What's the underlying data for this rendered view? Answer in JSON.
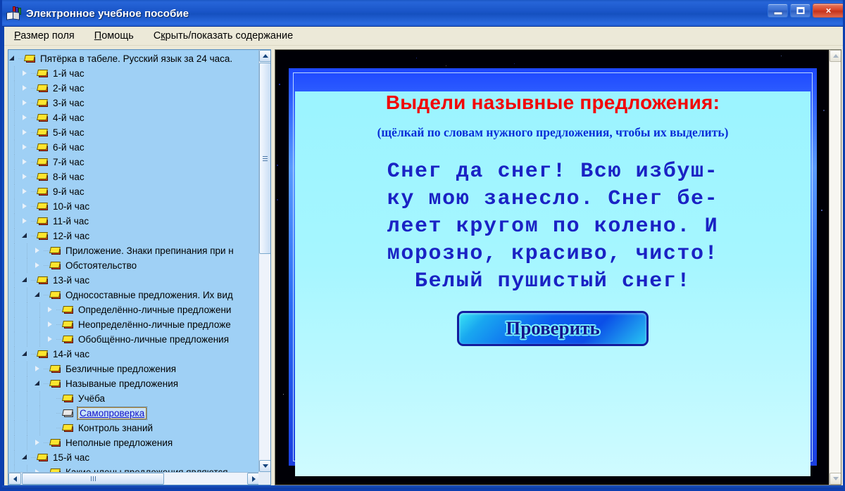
{
  "window": {
    "title": "Электронное учебное пособие",
    "icon": "open-book-icon",
    "buttons": {
      "minimize": "minimize-icon",
      "maximize": "maximize-icon",
      "close": "×"
    }
  },
  "menu": {
    "items": [
      {
        "id": "field-size",
        "pre": "",
        "acc": "Р",
        "post": "азмер поля"
      },
      {
        "id": "help",
        "pre": "",
        "acc": "П",
        "post": "омощь"
      },
      {
        "id": "toggle-contents",
        "pre": "С",
        "acc": "к",
        "post": "рыть/показать содержание"
      }
    ]
  },
  "tree": {
    "items": [
      {
        "label": "Пятёрка в табеле. Русский язык за 24 часа.",
        "level": 0,
        "state": "expanded",
        "icon": "yellow-book-icon"
      },
      {
        "label": "1-й час",
        "level": 1,
        "state": "collapsed",
        "icon": "yellow-book-icon"
      },
      {
        "label": "2-й час",
        "level": 1,
        "state": "collapsed",
        "icon": "yellow-book-icon"
      },
      {
        "label": "3-й час",
        "level": 1,
        "state": "collapsed",
        "icon": "yellow-book-icon"
      },
      {
        "label": "4-й час",
        "level": 1,
        "state": "collapsed",
        "icon": "yellow-book-icon"
      },
      {
        "label": "5-й час",
        "level": 1,
        "state": "collapsed",
        "icon": "yellow-book-icon"
      },
      {
        "label": "6-й час",
        "level": 1,
        "state": "collapsed",
        "icon": "yellow-book-icon"
      },
      {
        "label": "7-й час",
        "level": 1,
        "state": "collapsed",
        "icon": "yellow-book-icon"
      },
      {
        "label": "8-й час",
        "level": 1,
        "state": "collapsed",
        "icon": "yellow-book-icon"
      },
      {
        "label": "9-й час",
        "level": 1,
        "state": "collapsed",
        "icon": "yellow-book-icon"
      },
      {
        "label": "10-й час",
        "level": 1,
        "state": "collapsed",
        "icon": "yellow-book-icon"
      },
      {
        "label": "11-й час",
        "level": 1,
        "state": "collapsed",
        "icon": "yellow-book-icon"
      },
      {
        "label": "12-й час",
        "level": 1,
        "state": "expanded",
        "icon": "yellow-book-icon"
      },
      {
        "label": "Приложение. Знаки препинания при н",
        "level": 2,
        "state": "collapsed",
        "icon": "yellow-book-icon"
      },
      {
        "label": "Обстоятельство",
        "level": 2,
        "state": "collapsed",
        "icon": "yellow-book-icon"
      },
      {
        "label": "13-й час",
        "level": 1,
        "state": "expanded",
        "icon": "yellow-book-icon"
      },
      {
        "label": "Односоставные предложения. Их вид",
        "level": 2,
        "state": "expanded",
        "icon": "yellow-book-icon"
      },
      {
        "label": "Определённо-личные предложени",
        "level": 3,
        "state": "collapsed",
        "icon": "yellow-book-icon"
      },
      {
        "label": "Неопределённо-личные предложе",
        "level": 3,
        "state": "collapsed",
        "icon": "yellow-book-icon"
      },
      {
        "label": "Обобщённо-личные предложения",
        "level": 3,
        "state": "collapsed",
        "icon": "yellow-book-icon"
      },
      {
        "label": "14-й час",
        "level": 1,
        "state": "expanded",
        "icon": "yellow-book-icon"
      },
      {
        "label": "Безличные предложения",
        "level": 2,
        "state": "collapsed",
        "icon": "yellow-book-icon"
      },
      {
        "label": "Называные предложения",
        "level": 2,
        "state": "expanded",
        "icon": "yellow-book-icon"
      },
      {
        "label": "Учёба",
        "level": 3,
        "state": "leaf",
        "icon": "yellow-book-icon"
      },
      {
        "label": "Самопроверка",
        "level": 3,
        "state": "leaf",
        "icon": "open-book-icon",
        "selected": true
      },
      {
        "label": "Контроль знаний",
        "level": 3,
        "state": "leaf",
        "icon": "yellow-book-icon"
      },
      {
        "label": "Неполные предложения",
        "level": 2,
        "state": "collapsed",
        "icon": "yellow-book-icon"
      },
      {
        "label": "15-й час",
        "level": 1,
        "state": "expanded",
        "icon": "yellow-book-icon"
      },
      {
        "label": "Какие члены предложения являются",
        "level": 2,
        "state": "collapsed",
        "icon": "yellow-book-icon"
      }
    ]
  },
  "slide": {
    "title": "Выдели назывные предложения:",
    "subtitle": "(щёлкай по словам нужного предложения, чтобы их выделить)",
    "body_lines": [
      "Снег да снег! Всю избуш-",
      "ку мою занесло. Снег бе-",
      "леет кругом по колено. И",
      "морозно, красиво, чисто!",
      "Белый пушистый снег!"
    ],
    "check_button_label": "Проверить"
  },
  "colors": {
    "title_red": "#f20505",
    "subtitle_blue": "#0a2fd8",
    "body_blue": "#1a22c4",
    "slide_bg": "#9bf4ff",
    "frame_blue": "#1d47ff",
    "tree_bg": "#9fd0f5",
    "menu_bg": "#ece9d8",
    "selected_link": "#1010c8"
  }
}
